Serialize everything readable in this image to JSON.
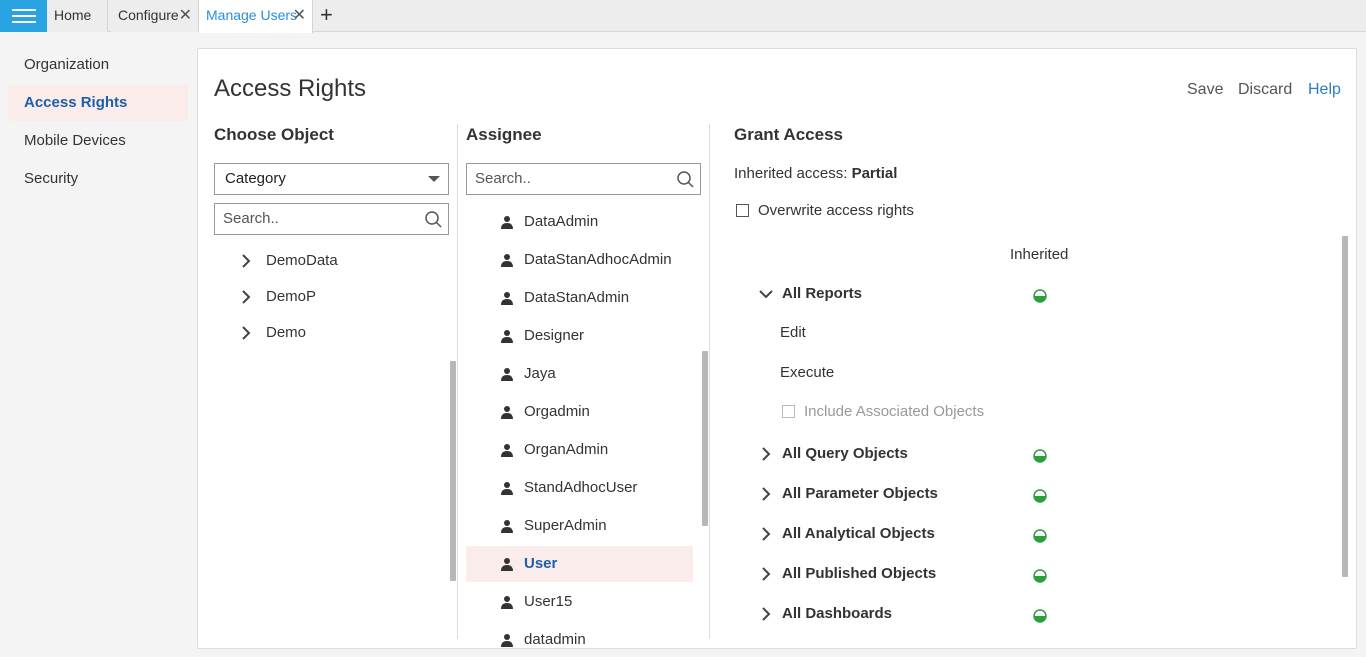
{
  "tabs": [
    {
      "label": "Home"
    },
    {
      "label": "Configure"
    },
    {
      "label": "Manage Users"
    }
  ],
  "sidebar": {
    "items": [
      {
        "label": "Organization"
      },
      {
        "label": "Access Rights"
      },
      {
        "label": "Mobile Devices"
      },
      {
        "label": "Security"
      }
    ]
  },
  "main": {
    "title": "Access Rights",
    "actions": {
      "save": "Save",
      "discard": "Discard",
      "help": "Help"
    },
    "choose_object": {
      "heading": "Choose Object",
      "select_value": "Category",
      "search_placeholder": "Search..",
      "tree": [
        "DemoData",
        "DemoP",
        "Demo"
      ]
    },
    "assignee": {
      "heading": "Assignee",
      "search_placeholder": "Search..",
      "users": [
        "DataAdmin",
        "DataStanAdhocAdmin",
        "DataStanAdmin",
        "Designer",
        "Jaya",
        "Orgadmin",
        "OrganAdmin",
        "StandAdhocUser",
        "SuperAdmin",
        "User",
        "User15",
        "datadmin"
      ],
      "selected": "User"
    },
    "grant_access": {
      "heading": "Grant Access",
      "inherited_label": "Inherited access:",
      "inherited_value": "Partial",
      "overwrite_label": "Overwrite access rights",
      "column_header": "Inherited",
      "all_reports": "All Reports",
      "sub_edit": "Edit",
      "sub_execute": "Execute",
      "include_associated": "Include Associated Objects",
      "groups": [
        "All Query Objects",
        "All Parameter Objects",
        "All Analytical Objects",
        "All Published Objects",
        "All Dashboards"
      ],
      "status_color": "#2e9e3e"
    }
  },
  "colors": {
    "accent": "#2aa3e2",
    "selected_bg": "#f9ecea",
    "selected_text": "#1f5fa8"
  }
}
